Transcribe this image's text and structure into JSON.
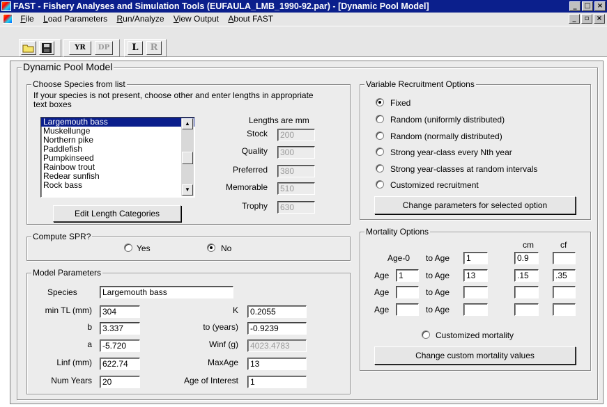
{
  "window": {
    "title": "FAST - Fishery Analyses and Simulation Tools (EUFAULA_LMB_1990-92.par) - [Dynamic Pool Model]",
    "icons": [
      "app-icon",
      "minimize-icon",
      "maximize-icon",
      "close-icon"
    ]
  },
  "menu": {
    "items": [
      "File",
      "Load Parameters",
      "Run/Analyze",
      "View Output",
      "About FAST"
    ]
  },
  "toolbar": {
    "yr": "YR",
    "dp": "DP",
    "l": "L",
    "r": "R",
    "icons": [
      "open-folder-icon",
      "save-icon"
    ]
  },
  "form": {
    "title": "Dynamic Pool Model"
  },
  "species_group": {
    "title": "Choose Species from list",
    "note": "If your species is not present, choose other and enter lengths in appropriate text boxes",
    "list": [
      "Largemouth bass",
      "Muskellunge",
      "Northern pike",
      "Paddlefish",
      "Pumpkinseed",
      "Rainbow trout",
      "Redear sunfish",
      "Rock bass"
    ],
    "selected": "Largemouth bass",
    "lengths_header": "Lengths are mm",
    "lengths": [
      {
        "label": "Stock",
        "value": "200"
      },
      {
        "label": "Quality",
        "value": "300"
      },
      {
        "label": "Preferred",
        "value": "380"
      },
      {
        "label": "Memorable",
        "value": "510"
      },
      {
        "label": "Trophy",
        "value": "630"
      }
    ],
    "edit_button": "Edit Length Categories"
  },
  "spr_group": {
    "title": "Compute SPR?",
    "yes": "Yes",
    "no": "No",
    "selected": "No"
  },
  "model_params": {
    "title": "Model Parameters",
    "species_label": "Species",
    "species_value": "Largemouth bass",
    "min_tl_label": "min TL (mm)",
    "min_tl": "304",
    "b_label": "b",
    "b": "3.337",
    "a_label": "a",
    "a": "-5.720",
    "linf_label": "Linf (mm)",
    "linf": "622.74",
    "num_years_label": "Num Years",
    "num_years": "20",
    "k_label": "K",
    "k": "0.2055",
    "t0_label": "to (years)",
    "t0": "-0.9239",
    "winf_label": "Winf (g)",
    "winf": "4023.4783",
    "maxage_label": "MaxAge",
    "maxage": "13",
    "age_interest_label": "Age of Interest",
    "age_interest": "1"
  },
  "recruitment": {
    "title": "Variable Recruitment Options",
    "options": [
      "Fixed",
      "Random (uniformly distributed)",
      "Random (normally distributed)",
      "Strong year-class every Nth year",
      "Strong year-classes at random intervals",
      "Customized recruitment"
    ],
    "selected": "Fixed",
    "button": "Change parameters for selected option"
  },
  "mortality": {
    "title": "Mortality Options",
    "cm_header": "cm",
    "cf_header": "cf",
    "age0_label": "Age-0",
    "age_label": "Age",
    "to_age_label": "to Age",
    "rows": [
      {
        "from": "",
        "to": "1",
        "cm": "0.9",
        "cf": ""
      },
      {
        "from": "1",
        "to": "13",
        "cm": ".15",
        "cf": ".35"
      },
      {
        "from": "",
        "to": "",
        "cm": "",
        "cf": ""
      },
      {
        "from": "",
        "to": "",
        "cm": "",
        "cf": ""
      }
    ],
    "custom_label": "Customized mortality",
    "button": "Change custom mortality values"
  }
}
